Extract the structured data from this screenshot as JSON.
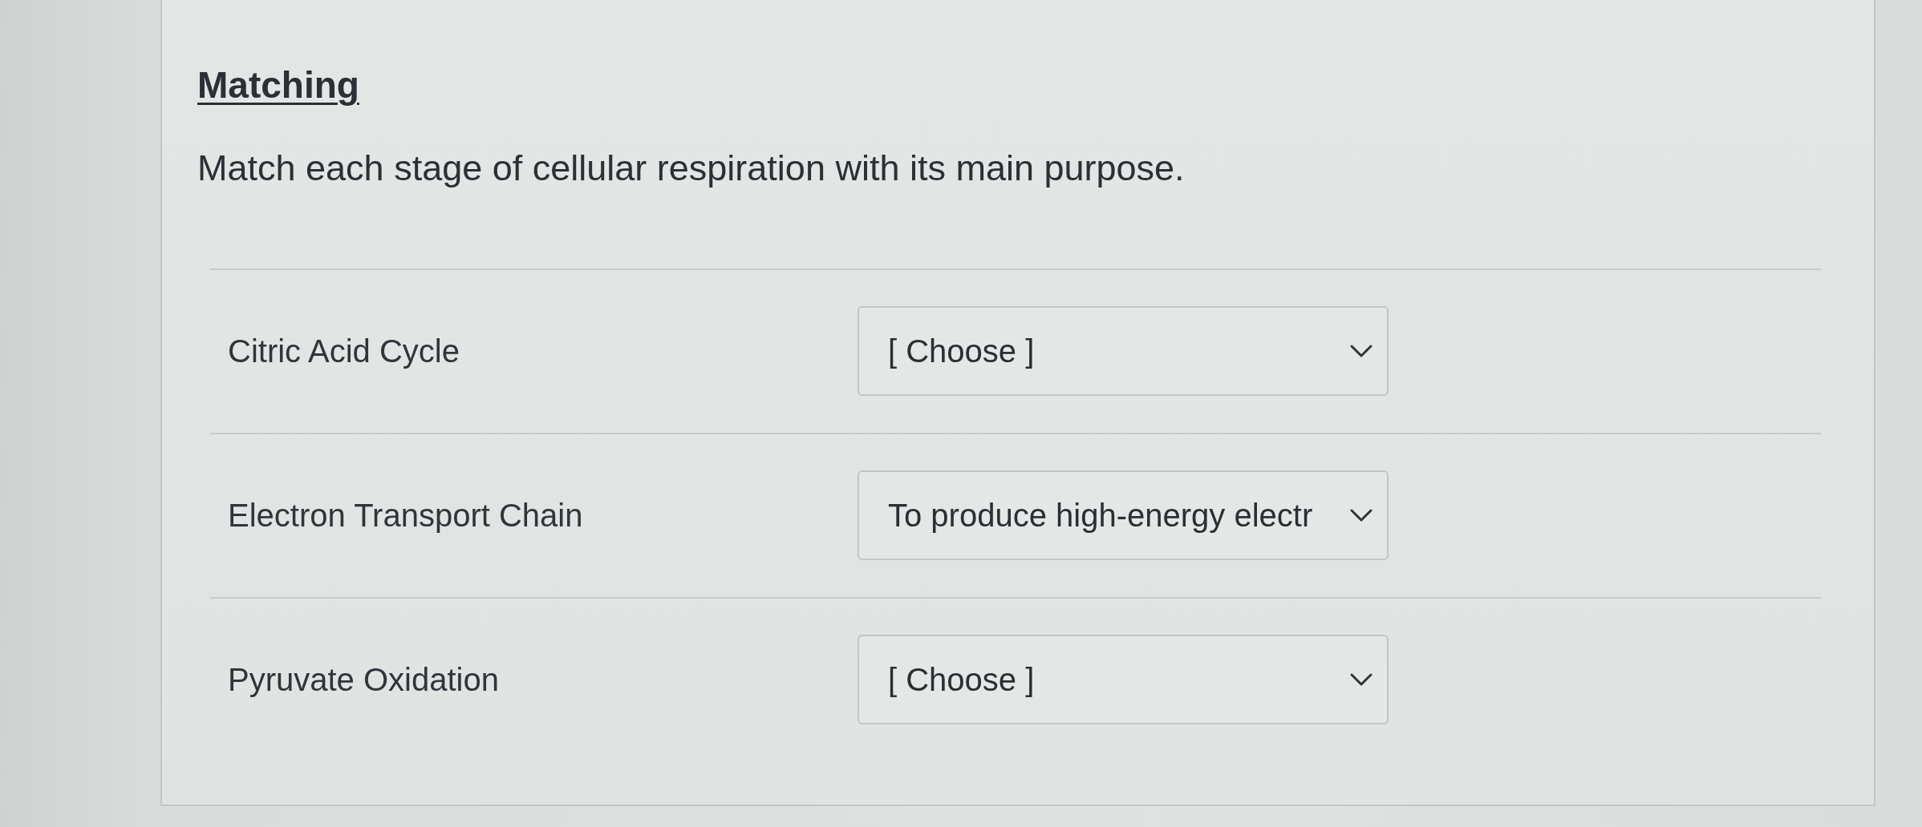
{
  "question": {
    "title": "Matching",
    "prompt": "Match each stage of cellular respiration with its main purpose."
  },
  "pairs": [
    {
      "term": "Citric Acid Cycle",
      "answer": "[ Choose ]"
    },
    {
      "term": "Electron Transport Chain",
      "answer": "To produce high-energy electr"
    },
    {
      "term": "Pyruvate Oxidation",
      "answer": "[ Choose ]"
    }
  ]
}
